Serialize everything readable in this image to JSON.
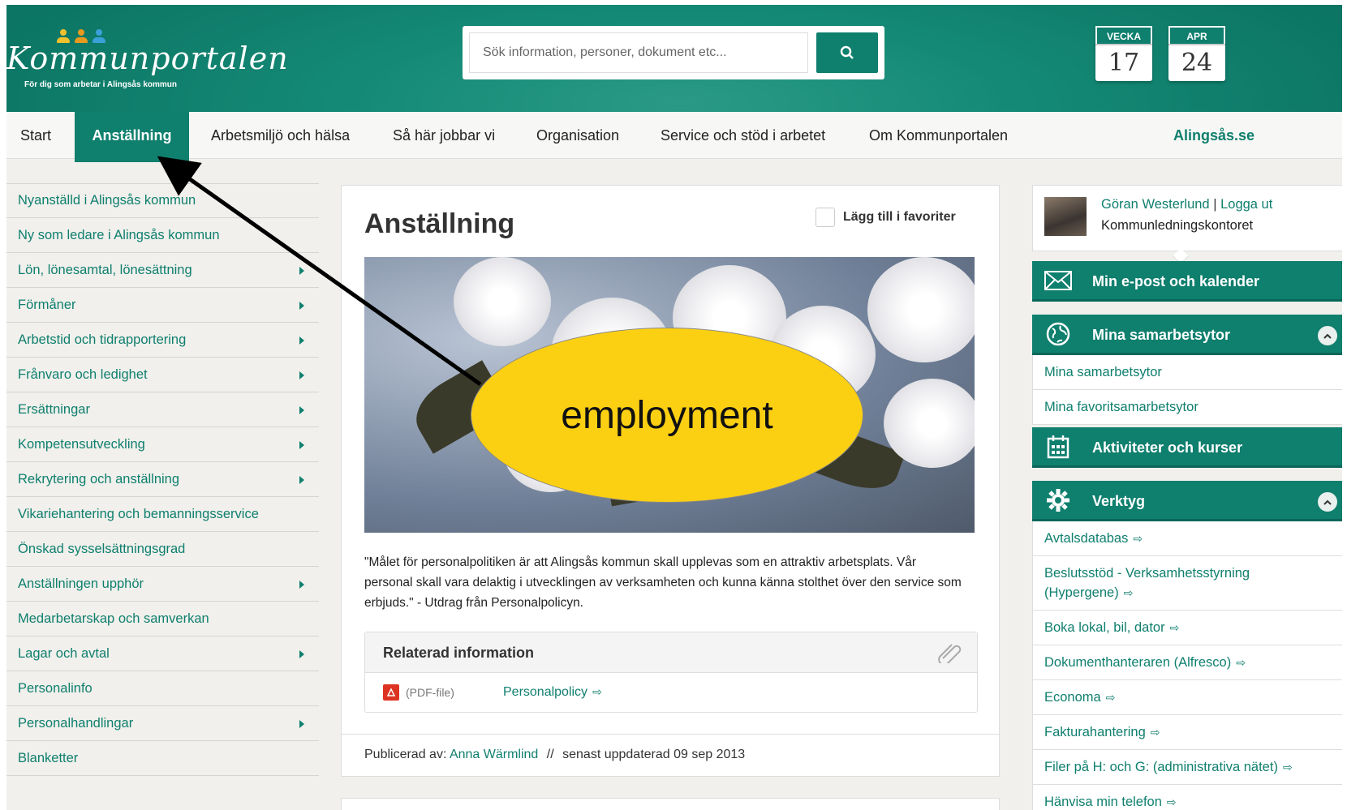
{
  "header": {
    "logo_name": "Kommunportalen",
    "logo_tagline": "För dig som arbetar i Alingsås kommun",
    "logo_people_colors": [
      "#f2c12e",
      "#e89a1e",
      "#3aa0d8"
    ],
    "search_placeholder": "Sök information, personer, dokument etc...",
    "search_icon": "search-icon",
    "week_label": "VECKA",
    "week_number": "17",
    "month_label": "APR",
    "day_number": "24"
  },
  "nav": {
    "items": [
      "Start",
      "Anställning",
      "Arbetsmiljö och hälsa",
      "Så här jobbar vi",
      "Organisation",
      "Service och stöd i arbetet",
      "Om Kommunportalen"
    ],
    "external_link": "Alingsås.se",
    "active": "Anställning"
  },
  "left_menu": [
    {
      "label": "Nyanställd i Alingsås kommun",
      "arrow": false
    },
    {
      "label": "Ny som ledare i Alingsås kommun",
      "arrow": false
    },
    {
      "label": "Lön, lönesamtal, lönesättning",
      "arrow": true
    },
    {
      "label": "Förmåner",
      "arrow": true
    },
    {
      "label": "Arbetstid och tidrapportering",
      "arrow": true
    },
    {
      "label": "Frånvaro och ledighet",
      "arrow": true
    },
    {
      "label": "Ersättningar",
      "arrow": true
    },
    {
      "label": "Kompetensutveckling",
      "arrow": true
    },
    {
      "label": "Rekrytering och anställning",
      "arrow": true
    },
    {
      "label": "Vikariehantering och bemanningsservice",
      "arrow": false
    },
    {
      "label": "Önskad sysselsättningsgrad",
      "arrow": false
    },
    {
      "label": "Anställningen upphör",
      "arrow": true
    },
    {
      "label": "Medarbetarskap och samverkan",
      "arrow": false
    },
    {
      "label": "Lagar och avtal",
      "arrow": true
    },
    {
      "label": "Personalinfo",
      "arrow": false
    },
    {
      "label": "Personalhandlingar",
      "arrow": true
    },
    {
      "label": "Blanketter",
      "arrow": false
    }
  ],
  "main": {
    "title": "Anställning",
    "favorite_label": "Lägg till i favoriter",
    "quote": "\"Målet för personalpolitiken är att Alingsås kommun skall upplevas som en attraktiv arbetsplats. Vår personal skall vara delaktig i utvecklingen av verksamheten och kunna känna stolthet över den service som erbjuds.\" - Utdrag från Personalpolicyn.",
    "related_title": "Relaterad information",
    "related_type": "(PDF-file)",
    "related_link": "Personalpolicy",
    "published_label": "Publicerad av:",
    "published_by": "Anna Wärmlind",
    "published_sep": "//",
    "updated_label": "senast uppdaterad",
    "updated_date": "09 sep 2013"
  },
  "user": {
    "name": "Göran Westerlund",
    "sep": "|",
    "logout": "Logga ut",
    "org": "Kommunledningskontoret"
  },
  "right": {
    "mail": {
      "label": "Min e-post och kalender",
      "icon": "envelope-icon"
    },
    "collab": {
      "label": "Mina samarbetsytor",
      "icon": "globe-icon",
      "items": [
        "Mina samarbetsytor",
        "Mina favoritsamarbetsytor"
      ]
    },
    "activities": {
      "label": "Aktiviteter och kurser",
      "icon": "calendar-icon"
    },
    "tools": {
      "label": "Verktyg",
      "icon": "gear-icon",
      "items": [
        "Avtalsdatabas",
        "Beslutsstöd - Verksamhetsstyrning (Hypergene)",
        "Boka lokal, bil, dator",
        "Dokumenthanteraren (Alfresco)",
        "Economa",
        "Fakturahantering",
        "Filer på H: och G: (administrativa nätet)",
        "Hänvisa min telefon"
      ]
    }
  },
  "annotation": {
    "text": "employment"
  },
  "colors": {
    "brand": "#0f7f6e",
    "highlight": "#fcd012"
  }
}
